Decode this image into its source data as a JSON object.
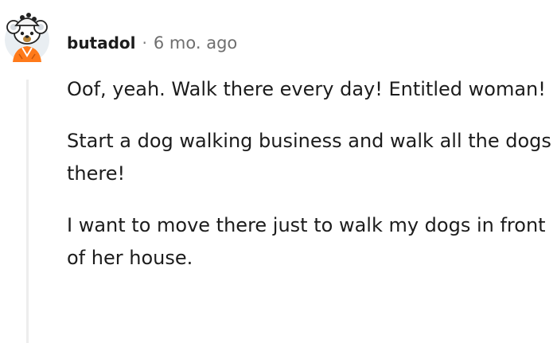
{
  "comment": {
    "author": "butadol",
    "separator": "·",
    "timestamp": "6 mo. ago",
    "avatar_icon": "snoo-avatar-icon",
    "paragraphs": [
      "Oof, yeah. Walk there every day! Entitled woman!",
      "Start a dog walking business and walk all the dogs there!",
      "I want to move there just to walk my dogs in front of her house."
    ]
  }
}
